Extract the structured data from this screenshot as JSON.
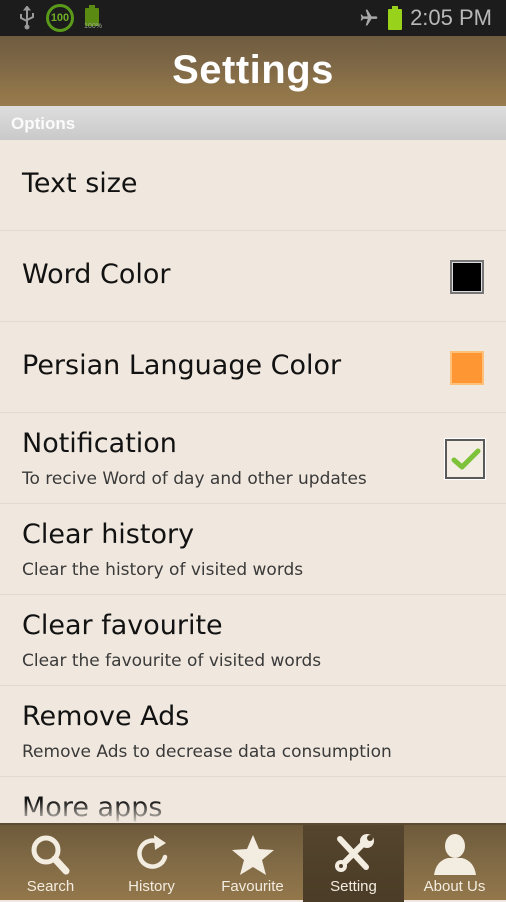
{
  "status_bar": {
    "level_indicator": "100",
    "battery_small_percent": "100%",
    "clock": "2:05 PM",
    "icons": [
      "usb-icon",
      "level-100-icon",
      "battery-full-icon",
      "airplane-mode-icon",
      "battery-icon"
    ]
  },
  "header": {
    "title": "Settings"
  },
  "section": {
    "label": "Options"
  },
  "settings": [
    {
      "title": "Text size"
    },
    {
      "title": "Word Color",
      "swatch_color": "#000000"
    },
    {
      "title": "Persian Language Color",
      "swatch_color": "#fe9733"
    },
    {
      "title": "Notification",
      "subtitle": "To recive Word of day and other updates",
      "checked": true
    },
    {
      "title": "Clear history",
      "subtitle": "Clear the history of visited words"
    },
    {
      "title": "Clear favourite",
      "subtitle": "Clear the favourite of visited words"
    },
    {
      "title": "Remove Ads",
      "subtitle": "Remove Ads to decrease data consumption"
    },
    {
      "title": "More apps"
    }
  ],
  "tabs": [
    {
      "label": "Search",
      "icon": "search-icon"
    },
    {
      "label": "History",
      "icon": "history-icon"
    },
    {
      "label": "Favourite",
      "icon": "star-icon"
    },
    {
      "label": "Setting",
      "icon": "tools-icon",
      "active": true
    },
    {
      "label": "About Us",
      "icon": "person-icon"
    }
  ],
  "colors": {
    "header": "#7d6746",
    "background": "#f0e8de",
    "accent_green": "#99d21a"
  }
}
